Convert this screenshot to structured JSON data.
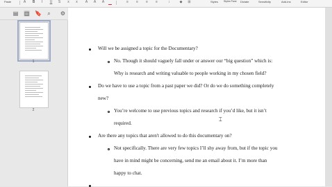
{
  "ribbon": {
    "paste_label": "Paste",
    "styles_label": "Styles",
    "styles_pane_label": "Styles Pane",
    "dictate_label": "Dictate",
    "sensitivity_label": "Sensitivity",
    "add_ins_label": "Add-ins",
    "editor_label": "Editor"
  },
  "sidebar": {
    "pages": [
      {
        "number": "1"
      },
      {
        "number": "2"
      }
    ]
  },
  "document": {
    "q1": "Will we be assigned a topic for the Documentary?",
    "a1_line1": "No. Though it should vaguely fall under or answer our “big question” which is:",
    "a1_line2": "Why is research and writing valuable to people working in my chosen field?",
    "q2_line1": "Do we have to use a topic from a past paper we did? Or do we do something completely",
    "q2_line2": "new?",
    "a2_line1": "You’re welcome to use previous topics and research if you’d like, but it isn’t",
    "a2_line2": "required.",
    "q3": "Are there any topics that aren't allowed to do this documentary on?",
    "a3_line1": "Not specifically. There are very few topics I’ll shy away from, but if the topic you",
    "a3_line2": "have in mind might be concerning, send me an email about it. I’m more than",
    "a3_line3": "happy to chat."
  }
}
